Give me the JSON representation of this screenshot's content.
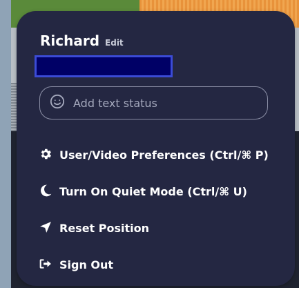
{
  "profile": {
    "name": "Richard",
    "edit_label": "Edit"
  },
  "status": {
    "placeholder": "Add text status",
    "icon": "smiley-icon"
  },
  "menu": {
    "items": [
      {
        "label": "User/Video Preferences (Ctrl/⌘ P)",
        "icon": "gear-icon"
      },
      {
        "label": "Turn On Quiet Mode (Ctrl/⌘ U)",
        "icon": "moon-icon"
      },
      {
        "label": "Reset Position",
        "icon": "location-arrow-icon"
      },
      {
        "label": "Sign Out",
        "icon": "sign-out-icon"
      }
    ]
  },
  "colors": {
    "card_background": "#242742",
    "redaction_fill": "#000066",
    "redaction_border": "#3b4bd6"
  }
}
